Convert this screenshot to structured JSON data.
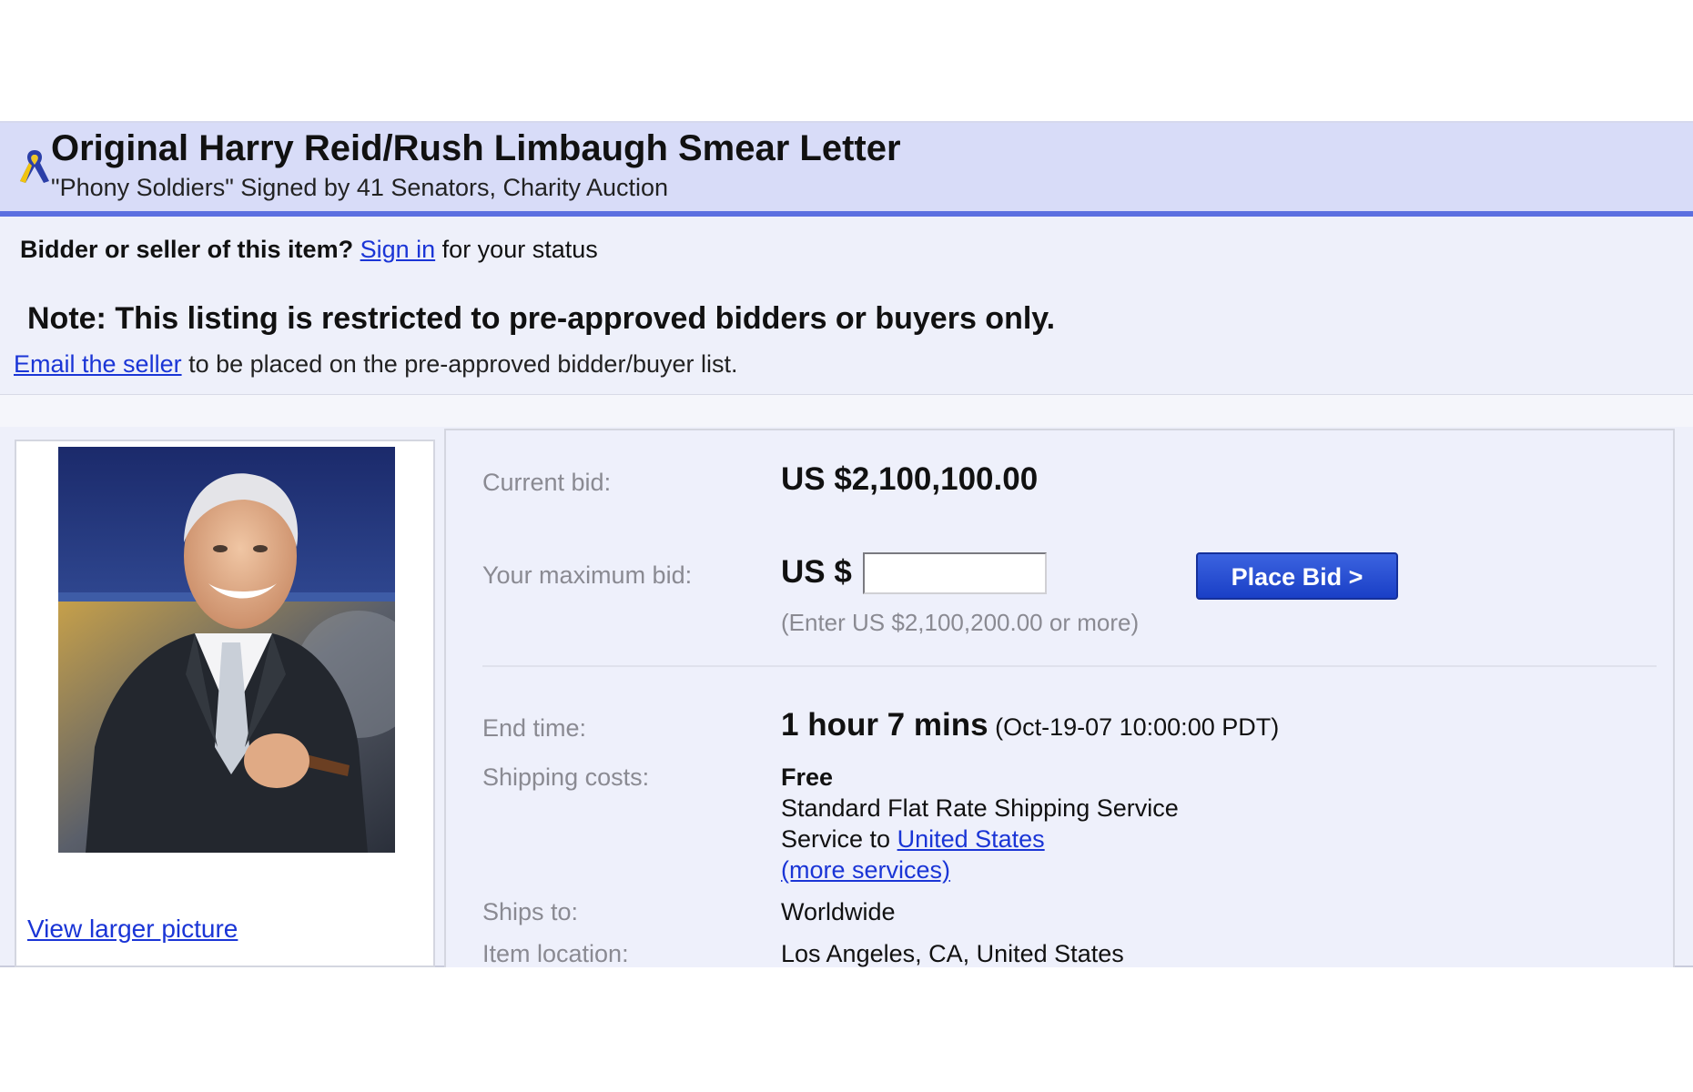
{
  "header": {
    "title": "Original Harry Reid/Rush Limbaugh Smear Letter",
    "subtitle": "\"Phony Soldiers\" Signed by 41 Senators, Charity Auction",
    "icon": "support-ribbon-icon"
  },
  "status": {
    "prompt": "Bidder or seller of this item?",
    "sign_in_link": "Sign in",
    "suffix": "for your status"
  },
  "notice": {
    "note": "Note: This listing is restricted to pre-approved bidders or buyers only.",
    "email_link": "Email the seller",
    "email_suffix": "to be placed on the pre-approved bidder/buyer list."
  },
  "photo": {
    "view_larger_link": "View larger picture"
  },
  "bid": {
    "current_bid_label": "Current bid:",
    "current_bid_value": "US $2,100,100.00",
    "max_bid_label": "Your maximum bid:",
    "max_bid_prefix": "US $",
    "max_bid_input_value": "",
    "place_bid_label": "Place Bid >",
    "hint": "(Enter US $2,100,200.00 or more)"
  },
  "details": {
    "end_time_label": "End time:",
    "end_time_value": "1 hour 7 mins",
    "end_time_date": "(Oct-19-07 10:00:00 PDT)",
    "shipping_label": "Shipping costs:",
    "shipping_cost": "Free",
    "shipping_service": "Standard Flat Rate Shipping Service",
    "service_to_prefix": "Service to",
    "service_to_link": "United States",
    "more_services_link": "(more services)",
    "ships_to_label": "Ships to:",
    "ships_to_value": "Worldwide",
    "location_label": "Item location:",
    "location_value": "Los Angeles, CA, United States"
  },
  "colors": {
    "header_bg": "#d8dcf8",
    "header_border": "#5b6fe0",
    "link": "#1a35d6",
    "button": "#1a3fc6",
    "panel_bg": "#eef0fb"
  }
}
